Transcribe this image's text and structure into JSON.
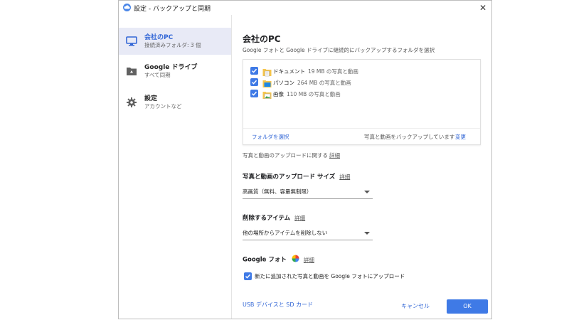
{
  "window": {
    "title": "設定 - バックアップと同期",
    "close_glyph": "✕"
  },
  "sidebar": {
    "items": [
      {
        "label": "会社のPC",
        "sub": "接続済みフォルダ: 3 個",
        "icon": "monitor-icon",
        "selected": true
      },
      {
        "label": "Google ドライブ",
        "sub": "すべて同期",
        "icon": "drive-folder-icon",
        "selected": false
      },
      {
        "label": "設定",
        "sub": "アカウントなど",
        "icon": "gear-icon",
        "selected": false
      }
    ]
  },
  "main": {
    "title": "会社のPC",
    "description": "Google フォトと Google ドライブに継続的にバックアップするフォルダを選択",
    "folders": [
      {
        "name": "ドキュメント",
        "size": "19 MB の写真と動画",
        "checked": true
      },
      {
        "name": "パソコン",
        "size": "264 MB の写真と動画",
        "checked": true
      },
      {
        "name": "画像",
        "size": "110 MB の写真と動画",
        "checked": true
      }
    ],
    "select_folders_link": "フォルダを選択",
    "backup_status": "写真と動画をバックアップしています",
    "change_link": "変更",
    "upload_detail_text": "写真と動画のアップロードに関する",
    "detail_label": "詳細",
    "upload_size": {
      "heading": "写真と動画のアップロード サイズ",
      "value": "高画質（無料、容量無制限）"
    },
    "delete_items": {
      "heading": "削除するアイテム",
      "value": "他の場所からアイテムを削除しない"
    },
    "google_photos": {
      "heading": "Google フォト",
      "checkbox_label": "新たに追加された写真と動画を Google フォトにアップロード",
      "checked": true
    },
    "usb_link": "USB デバイスと SD カード",
    "cancel_label": "キャンセル",
    "ok_label": "OK"
  },
  "colors": {
    "accent": "#3f7ae6",
    "link": "#3367d6",
    "selected_bg": "#e8eaf6"
  }
}
